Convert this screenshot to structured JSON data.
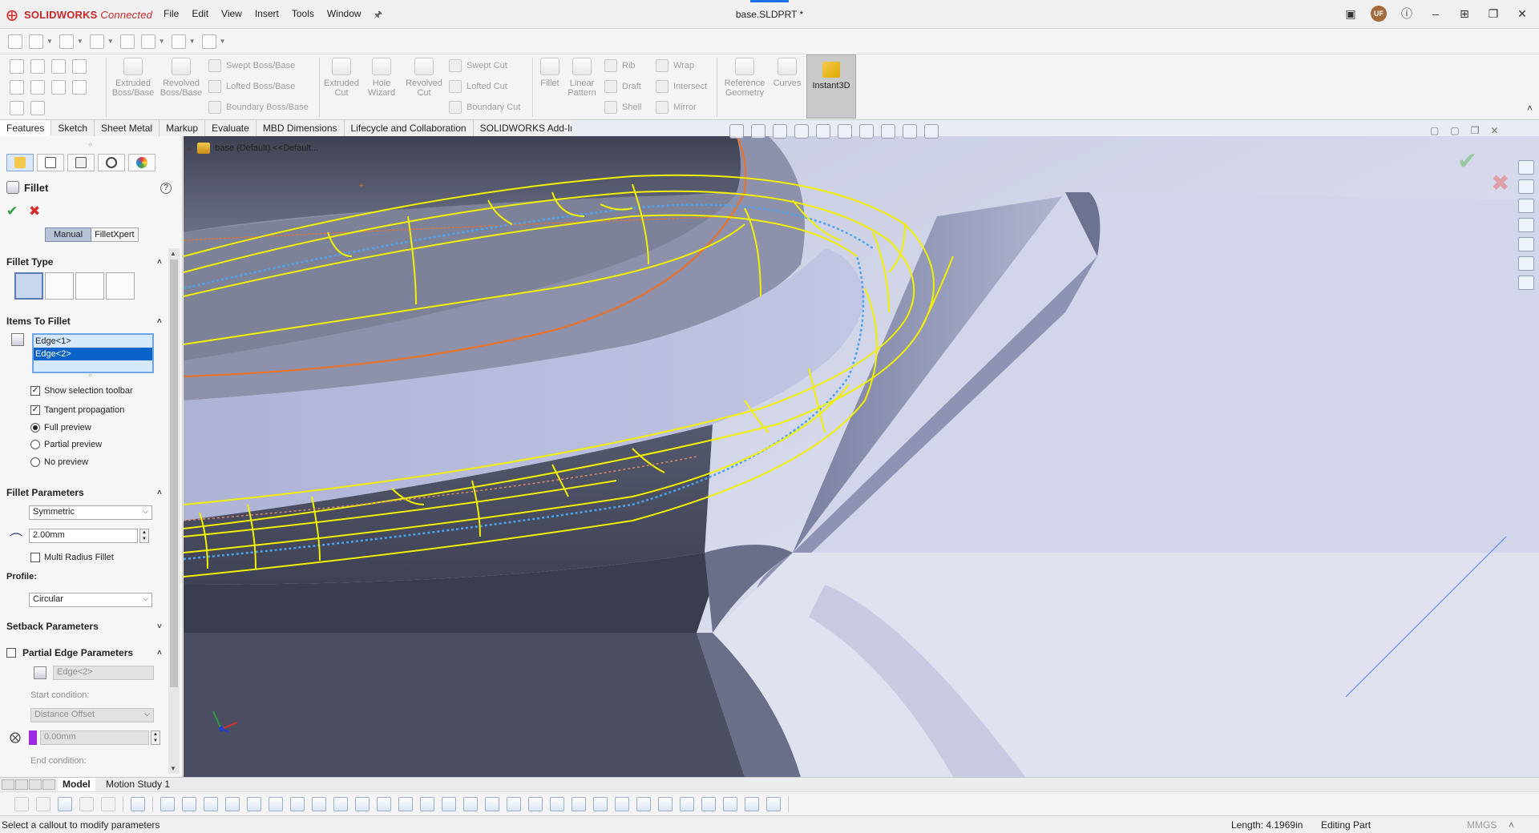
{
  "app": {
    "brand_prefix": "SOLIDWORKS",
    "brand_suffix": " Connected",
    "doc_title": "base.SLDPRT *",
    "user_initials": "UF",
    "menus": [
      "File",
      "Edit",
      "View",
      "Insert",
      "Tools",
      "Window"
    ]
  },
  "ribbon": {
    "boss_base": [
      {
        "name": "extruded-boss-base-button",
        "label": "Extruded\nBoss/Base"
      },
      {
        "name": "revolved-boss-base-button",
        "label": "Revolved\nBoss/Base"
      }
    ],
    "boss_small": [
      "Swept Boss/Base",
      "Lofted Boss/Base",
      "Boundary Boss/Base"
    ],
    "cut": [
      {
        "name": "extruded-cut-button",
        "label": "Extruded\nCut"
      },
      {
        "name": "hole-wizard-button",
        "label": "Hole\nWizard"
      },
      {
        "name": "revolved-cut-button",
        "label": "Revolved\nCut"
      }
    ],
    "cut_small": [
      "Swept Cut",
      "Lofted Cut",
      "Boundary Cut"
    ],
    "features": [
      {
        "name": "fillet-button",
        "label": "Fillet"
      },
      {
        "name": "linear-pattern-button",
        "label": "Linear\nPattern"
      }
    ],
    "features_small": [
      "Rib",
      "Draft",
      "Shell"
    ],
    "features_small2": [
      "Wrap",
      "Intersect",
      "Mirror"
    ],
    "ref": [
      {
        "name": "reference-geometry-button",
        "label": "Reference\nGeometry"
      },
      {
        "name": "curves-button",
        "label": "Curves"
      }
    ],
    "instant3d": "Instant3D"
  },
  "tabs": [
    "Features",
    "Sketch",
    "Sheet Metal",
    "Markup",
    "Evaluate",
    "MBD Dimensions",
    "Lifecycle and Collaboration",
    "SOLIDWORKS Add-Ins"
  ],
  "property_manager": {
    "title": "Fillet",
    "mode_manual": "Manual",
    "mode_filletxpert": "FilletXpert",
    "fillet_type_header": "Fillet Type",
    "items_header": "Items To Fillet",
    "items": [
      "Edge<1>",
      "Edge<2>"
    ],
    "show_selection_toolbar": "Show selection toolbar",
    "tangent_propagation": "Tangent propagation",
    "full_preview": "Full preview",
    "partial_preview": "Partial preview",
    "no_preview": "No preview",
    "fillet_params_header": "Fillet Parameters",
    "fillet_method": "Symmetric",
    "radius": "2.00mm",
    "multi_radius": "Multi Radius Fillet",
    "profile_label": "Profile:",
    "profile_value": "Circular",
    "setback_header": "Setback Parameters",
    "partial_edge_header": "Partial Edge Parameters",
    "partial_edge_field": "Edge<2>",
    "start_condition_label": "Start condition:",
    "start_condition_value": "Distance Offset",
    "offset_value": "0.00mm",
    "end_condition_label": "End condition:"
  },
  "viewport": {
    "tree_label": "base  (Default) <<Default..."
  },
  "bottom_tabs": [
    "Model",
    "Motion Study 1"
  ],
  "status": {
    "message": "Select a callout to modify parameters",
    "length": "Length: 4.1969in",
    "mode": "Editing Part",
    "units": "MMGS"
  },
  "colors": {
    "accent": "#1a73e8",
    "preview_yellow": "#f0f000",
    "selection_orange": "#f07020",
    "tangent_blue": "#4aa3f0",
    "part_dark": "#4a4d5e",
    "part_light": "#a7acd0"
  }
}
